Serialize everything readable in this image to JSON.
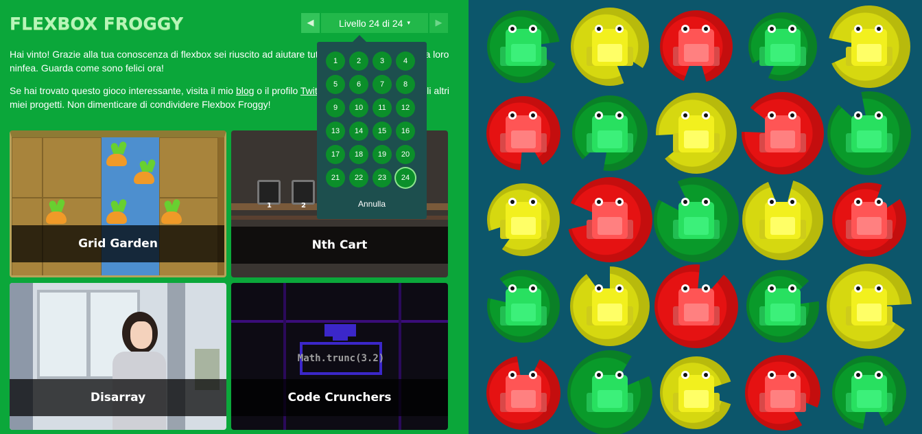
{
  "app": {
    "title": "FLEXBOX FROGGY"
  },
  "level_nav": {
    "prev_arrow": "◀",
    "next_arrow": "▶",
    "level_label": "Livello 24 di 24",
    "caret": "▾"
  },
  "message": {
    "p1": "Hai vinto! Grazie alla tua conoscenza di flexbox sei riuscito ad aiutare tutte le rane a raggiungere la loro ninfea. Guarda come sono felici ora!",
    "p2_prefix": "Se hai trovato questo gioco interessante, visita il mio ",
    "blog_link": "blog",
    "p2_middle": " o il profilo ",
    "twitter_link": "Twitter",
    "p2_suffix": " per aggiornamenti sugli altri miei progetti. Non dimenticare di condividere Flexbox Froggy!"
  },
  "games": [
    {
      "title": "Grid Garden"
    },
    {
      "title": "Nth Cart"
    },
    {
      "title": "Disarray"
    },
    {
      "title": "Code Crunchers"
    }
  ],
  "code_snippet": "Math.trunc(3.2)",
  "cart_numbers": [
    "1",
    "2"
  ],
  "dropdown": {
    "levels": [
      "1",
      "2",
      "3",
      "4",
      "5",
      "6",
      "7",
      "8",
      "9",
      "10",
      "11",
      "12",
      "13",
      "14",
      "15",
      "16",
      "17",
      "18",
      "19",
      "20",
      "21",
      "22",
      "23",
      "24"
    ],
    "current_level": "24",
    "cancel_label": "Annulla"
  },
  "colors": {
    "panel_green": "#0ba73a",
    "pond_blue": "#0c566b",
    "pad_green": "#099a2a",
    "pad_yellow": "#d6d810",
    "pad_red": "#e51212",
    "frog_green": "#28e060",
    "frog_yellow": "#f2f01e",
    "frog_red": "#ff5555"
  },
  "pond": {
    "pads": [
      [
        "green",
        "yellow",
        "red",
        "green",
        "yellow"
      ],
      [
        "red",
        "green",
        "yellow",
        "red",
        "green"
      ],
      [
        "yellow",
        "red",
        "green",
        "yellow",
        "red"
      ],
      [
        "green",
        "yellow",
        "red",
        "green",
        "yellow"
      ],
      [
        "red",
        "green",
        "yellow",
        "red",
        "green"
      ]
    ],
    "frogs": [
      [
        "green",
        "yellow",
        "red",
        "green",
        "yellow"
      ],
      [
        "red",
        "green",
        "yellow",
        "red",
        "green"
      ],
      [
        "yellow",
        "red",
        "green",
        "yellow",
        "red"
      ],
      [
        "green",
        "yellow",
        "red",
        "green",
        "yellow"
      ],
      [
        "red",
        "green",
        "yellow",
        "red",
        "green"
      ]
    ]
  }
}
